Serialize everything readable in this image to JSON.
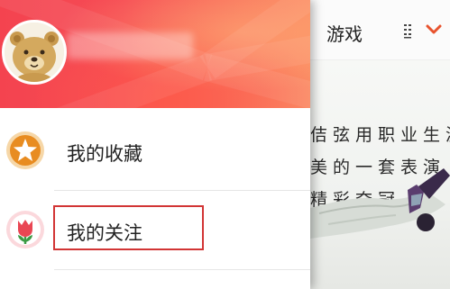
{
  "content": {
    "tab_label": "游戏",
    "article_lines": [
      "佶弦用职业生涯",
      "美的一套表演",
      "精彩夺冠"
    ]
  },
  "drawer": {
    "menu": [
      {
        "label": "我的收藏",
        "icon": "star-icon"
      },
      {
        "label": "我的关注",
        "icon": "tulip-icon"
      }
    ]
  },
  "colors": {
    "header_red": "#f4434f",
    "highlight_border": "#d23535",
    "accent_orange": "#e8532e"
  }
}
